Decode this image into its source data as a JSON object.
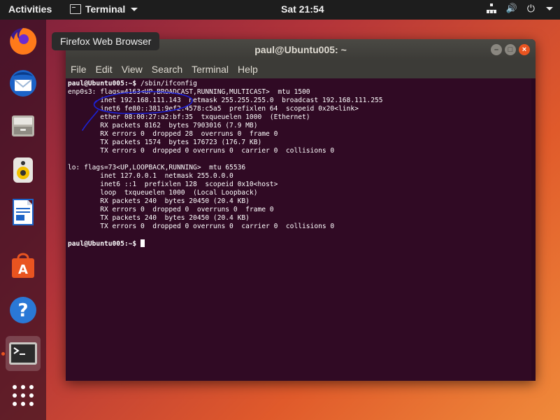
{
  "topbar": {
    "activities": "Activities",
    "app_name": "Terminal",
    "clock": "Sat 21:54",
    "tray_icons": [
      "network-icon",
      "volume-icon",
      "power-icon"
    ]
  },
  "dock": {
    "items": [
      {
        "name": "firefox",
        "tooltip": "Firefox Web Browser"
      },
      {
        "name": "thunderbird"
      },
      {
        "name": "files"
      },
      {
        "name": "rhythmbox"
      },
      {
        "name": "libreoffice-writer"
      },
      {
        "name": "ubuntu-software"
      },
      {
        "name": "help"
      },
      {
        "name": "terminal",
        "active": true
      },
      {
        "name": "show-applications"
      }
    ]
  },
  "tooltip": "Firefox Web Browser",
  "window": {
    "title": "paul@Ubuntu005: ~",
    "menu": [
      "File",
      "Edit",
      "View",
      "Search",
      "Terminal",
      "Help"
    ]
  },
  "terminal": {
    "prompt": "paul@Ubuntu005:~$",
    "command": " /sbin/ifconfig",
    "lines": [
      "enp0s3: flags=4163<UP,BROADCAST,RUNNING,MULTICAST>  mtu 1500",
      "        inet 192.168.111.143  netmask 255.255.255.0  broadcast 192.168.111.255",
      "        inet6 fe80::381:9ef2:4578:c5a5  prefixlen 64  scopeid 0x20<link>",
      "        ether 08:00:27:a2:bf:35  txqueuelen 1000  (Ethernet)",
      "        RX packets 8162  bytes 7903016 (7.9 MB)",
      "        RX errors 0  dropped 28  overruns 0  frame 0",
      "        TX packets 1574  bytes 176723 (176.7 KB)",
      "        TX errors 0  dropped 0 overruns 0  carrier 0  collisions 0",
      "",
      "lo: flags=73<UP,LOOPBACK,RUNNING>  mtu 65536",
      "        inet 127.0.0.1  netmask 255.0.0.0",
      "        inet6 ::1  prefixlen 128  scopeid 0x10<host>",
      "        loop  txqueuelen 1000  (Local Loopback)",
      "        RX packets 240  bytes 20450 (20.4 KB)",
      "        RX errors 0  dropped 0  overruns 0  frame 0",
      "        TX packets 240  bytes 20450 (20.4 KB)",
      "        TX errors 0  dropped 0 overruns 0  carrier 0  collisions 0",
      ""
    ],
    "final_prompt": "paul@Ubuntu005:~$",
    "annotation_color": "#1c22d8"
  }
}
